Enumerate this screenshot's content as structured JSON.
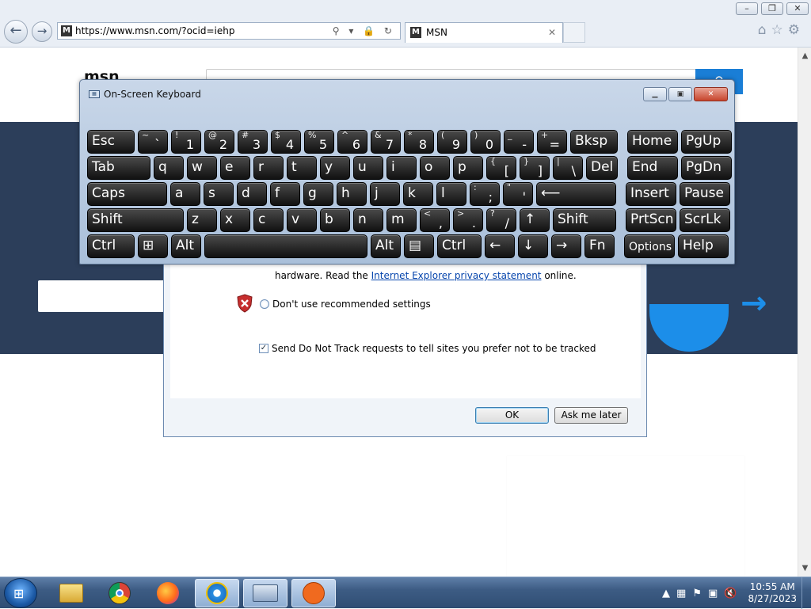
{
  "browser": {
    "url": "https://www.msn.com/?ocid=iehp",
    "favicon_letter": "M",
    "address_icons": "⚲ ▾ 🔒 ↻",
    "tab_title": "MSN",
    "tab_close": "✕",
    "tool_icons": [
      "home-icon",
      "star-icon",
      "gear-icon"
    ],
    "window_buttons": [
      "–",
      "❐",
      "✕"
    ],
    "back_glyph": "←",
    "forward_glyph": "→"
  },
  "page": {
    "logo": "msn",
    "search_btn_glyph": "⚲"
  },
  "dialog": {
    "privacy_prefix": "hardware. Read the ",
    "privacy_link": "Internet Explorer privacy statement",
    "privacy_suffix": " online.",
    "radio_label": "Don't use recommended settings",
    "checkbox_label": "Send Do Not Track requests to tell sites you prefer not to be tracked",
    "checkbox_checked": true,
    "ok_label": "OK",
    "later_label": "Ask me later"
  },
  "osk": {
    "title": "On-Screen Keyboard",
    "rows": [
      [
        {
          "label": "Esc"
        },
        {
          "shift": "~",
          "main": "`"
        },
        {
          "shift": "!",
          "main": "1"
        },
        {
          "shift": "@",
          "main": "2"
        },
        {
          "shift": "#",
          "main": "3"
        },
        {
          "shift": "$",
          "main": "4"
        },
        {
          "shift": "%",
          "main": "5"
        },
        {
          "shift": "^",
          "main": "6"
        },
        {
          "shift": "&",
          "main": "7"
        },
        {
          "shift": "*",
          "main": "8"
        },
        {
          "shift": "(",
          "main": "9"
        },
        {
          "shift": ")",
          "main": "0"
        },
        {
          "shift": "_",
          "main": "-"
        },
        {
          "shift": "+",
          "main": "="
        },
        {
          "label": "Bksp"
        },
        {
          "label": "Home"
        },
        {
          "label": "PgUp"
        }
      ],
      [
        {
          "label": "Tab"
        },
        {
          "label": "q"
        },
        {
          "label": "w"
        },
        {
          "label": "e"
        },
        {
          "label": "r"
        },
        {
          "label": "t"
        },
        {
          "label": "y"
        },
        {
          "label": "u"
        },
        {
          "label": "i"
        },
        {
          "label": "o"
        },
        {
          "label": "p"
        },
        {
          "shift": "{",
          "main": "["
        },
        {
          "shift": "}",
          "main": "]"
        },
        {
          "shift": "|",
          "main": "\\"
        },
        {
          "label": "Del"
        },
        {
          "label": "End"
        },
        {
          "label": "PgDn"
        }
      ],
      [
        {
          "label": "Caps"
        },
        {
          "label": "a"
        },
        {
          "label": "s"
        },
        {
          "label": "d"
        },
        {
          "label": "f"
        },
        {
          "label": "g"
        },
        {
          "label": "h"
        },
        {
          "label": "j"
        },
        {
          "label": "k"
        },
        {
          "label": "l"
        },
        {
          "shift": ":",
          "main": ";"
        },
        {
          "shift": "\"",
          "main": "'"
        },
        {
          "label": "⟵"
        },
        {
          "label": "Insert"
        },
        {
          "label": "Pause"
        }
      ],
      [
        {
          "label": "Shift"
        },
        {
          "label": "z"
        },
        {
          "label": "x"
        },
        {
          "label": "c"
        },
        {
          "label": "v"
        },
        {
          "label": "b"
        },
        {
          "label": "n"
        },
        {
          "label": "m"
        },
        {
          "shift": "<",
          "main": ","
        },
        {
          "shift": ">",
          "main": "."
        },
        {
          "shift": "?",
          "main": "/"
        },
        {
          "label": "↑"
        },
        {
          "label": "Shift"
        },
        {
          "label": "PrtScn"
        },
        {
          "label": "ScrLk"
        }
      ],
      [
        {
          "label": "Ctrl"
        },
        {
          "label": "⊞"
        },
        {
          "label": "Alt"
        },
        {
          "label": ""
        },
        {
          "label": "Alt"
        },
        {
          "label": "▤"
        },
        {
          "label": "Ctrl"
        },
        {
          "label": "←"
        },
        {
          "label": "↓"
        },
        {
          "label": "→"
        },
        {
          "label": "Fn"
        },
        {
          "label": "Options"
        },
        {
          "label": "Help"
        }
      ]
    ]
  },
  "taskbar": {
    "items": [
      "start-icon",
      "explorer-icon",
      "chrome-icon",
      "firefox-icon",
      "ie-icon",
      "osk-icon",
      "app-icon"
    ],
    "time": "10:55 AM",
    "date": "8/27/2023",
    "tray_icons": [
      "▲",
      "▦",
      "⚑",
      "▣",
      "🔇"
    ]
  }
}
